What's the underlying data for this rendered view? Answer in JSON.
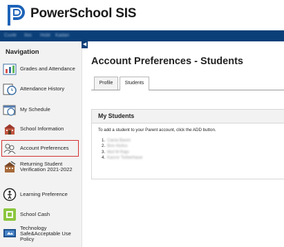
{
  "brand": {
    "name": "PowerSchool SIS"
  },
  "topbar": {
    "links": [
      "Cuvle",
      "Ilos",
      "Hobt",
      "Kadan"
    ]
  },
  "sidebar": {
    "title": "Navigation",
    "items": [
      {
        "label": "Grades and Attendance",
        "icon": "grades-chart-icon"
      },
      {
        "label": "Attendance History",
        "icon": "attendance-clock-icon"
      },
      {
        "label": "My Schedule",
        "icon": "schedule-calendar-icon"
      },
      {
        "label": "School Information",
        "icon": "school-building-icon"
      },
      {
        "label": "Account Preferences",
        "icon": "account-people-icon"
      },
      {
        "label": "Returning Student Verification 2021-2022",
        "icon": "verification-school-icon"
      },
      {
        "label": "Learning Preference",
        "icon": "learning-preference-icon"
      },
      {
        "label": "School Cash",
        "icon": "school-cash-icon"
      },
      {
        "label": "Technology Safe&Acceptable Use Policy",
        "icon": "technology-policy-icon"
      }
    ],
    "active_index": 4
  },
  "main": {
    "title": "Account Preferences - Students",
    "tabs": [
      {
        "label": "Profile"
      },
      {
        "label": "Students"
      }
    ],
    "active_tab": "Students",
    "panel": {
      "title": "My Students",
      "instructions": "To add a student to your Parent account, click the ADD button.",
      "students": [
        {
          "number": "1.",
          "name": "Cacta Baoni"
        },
        {
          "number": "2.",
          "name": "Bon Alufus"
        },
        {
          "number": "3.",
          "name": "Muf M Rajo"
        },
        {
          "number": "4.",
          "name": "Kacror Torberhaue"
        }
      ]
    }
  },
  "colors": {
    "topbar": "#0a3f78",
    "highlight": "#d32f2f",
    "sidebar_bg": "#f2f2f2"
  }
}
